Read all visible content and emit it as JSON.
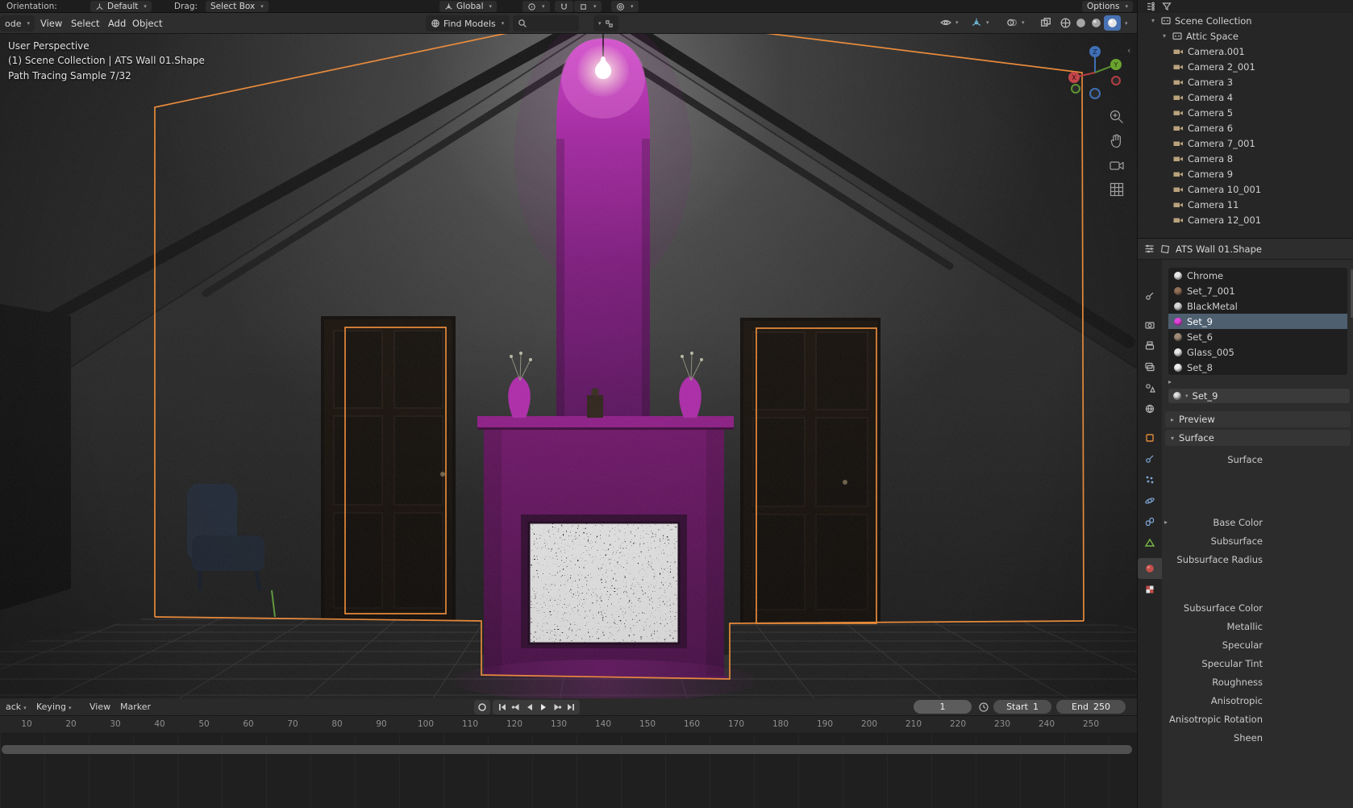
{
  "topbar": {
    "orientation_label": "Orientation:",
    "orientation_value": "Default",
    "drag_label": "Drag:",
    "drag_value": "Select Box",
    "transform_orientation": "Global",
    "options_label": "Options"
  },
  "viewport_header": {
    "mode_label": "ode",
    "menus": [
      "View",
      "Select",
      "Add",
      "Object"
    ],
    "find_models_label": "Find Models",
    "search_value": ""
  },
  "viewport": {
    "overlay_line1": "User Perspective",
    "overlay_line2": "(1) Scene Collection | ATS Wall 01.Shape",
    "overlay_line3": "Path Tracing Sample 7/32",
    "gizmo": {
      "x": "X",
      "y": "Y",
      "z": "Z"
    }
  },
  "outliner": {
    "root_label": "Scene Collection",
    "collection_label": "Attic Space",
    "cameras": [
      "Camera.001",
      "Camera 2_001",
      "Camera 3",
      "Camera 4",
      "Camera 5",
      "Camera 6",
      "Camera 7_001",
      "Camera 8",
      "Camera 9",
      "Camera 10_001",
      "Camera 11",
      "Camera 12_001"
    ]
  },
  "properties": {
    "breadcrumb": "ATS Wall 01.Shape",
    "material_slots": [
      {
        "name": "Chrome",
        "dot_style": "background:#e9e9e9",
        "selected": false
      },
      {
        "name": "Set_7_001",
        "dot_style": "background:#93705a",
        "selected": false
      },
      {
        "name": "BlackMetal",
        "dot_style": "background:#d8d8d8",
        "selected": false
      },
      {
        "name": "Set_9",
        "dot_style": "background:#e243da",
        "selected": true
      },
      {
        "name": "Set_6",
        "dot_style": "background:#a08c7a",
        "selected": false
      },
      {
        "name": "Glass_005",
        "dot_style": "background:#e9e9e9",
        "selected": false
      },
      {
        "name": "Set_8",
        "dot_style": "background:#efefef",
        "selected": false
      }
    ],
    "material_field_value": "Set_9",
    "preview_label": "Preview",
    "surface_section_label": "Surface",
    "fields": [
      "Surface",
      "Base Color",
      "Subsurface",
      "Subsurface Radius",
      "Subsurface Color",
      "Metallic",
      "Specular",
      "Specular Tint",
      "Roughness",
      "Anisotropic",
      "Anisotropic Rotation",
      "Sheen"
    ]
  },
  "timeline": {
    "menus": [
      "ack",
      "Keying",
      "View",
      "Marker"
    ],
    "current_frame": "1",
    "start_label": "Start",
    "start_value": "1",
    "end_label": "End",
    "end_value": "250",
    "ticks": [
      "10",
      "20",
      "30",
      "40",
      "50",
      "60",
      "70",
      "80",
      "90",
      "100",
      "110",
      "120",
      "130",
      "140",
      "150",
      "160",
      "170",
      "180",
      "190",
      "200",
      "210",
      "220",
      "230",
      "240",
      "250"
    ]
  },
  "colors": {
    "selection_outline_orange": "#f08a33",
    "accent_blue": "#4772b3",
    "chimney_purple": "#a926a6",
    "selected_slot_bg": "#4e5f70"
  },
  "icons": {
    "chevron-down-icon": "▾",
    "expand-open-icon": "▾",
    "expand-closed-icon": "▸",
    "search-icon": "magnifier",
    "magnet-icon": "U-magnet",
    "camera-icon": "movie-camera",
    "collection-icon": "box",
    "clock-icon": "clock",
    "record-icon": "circle",
    "play-icon": "triangle-right"
  }
}
